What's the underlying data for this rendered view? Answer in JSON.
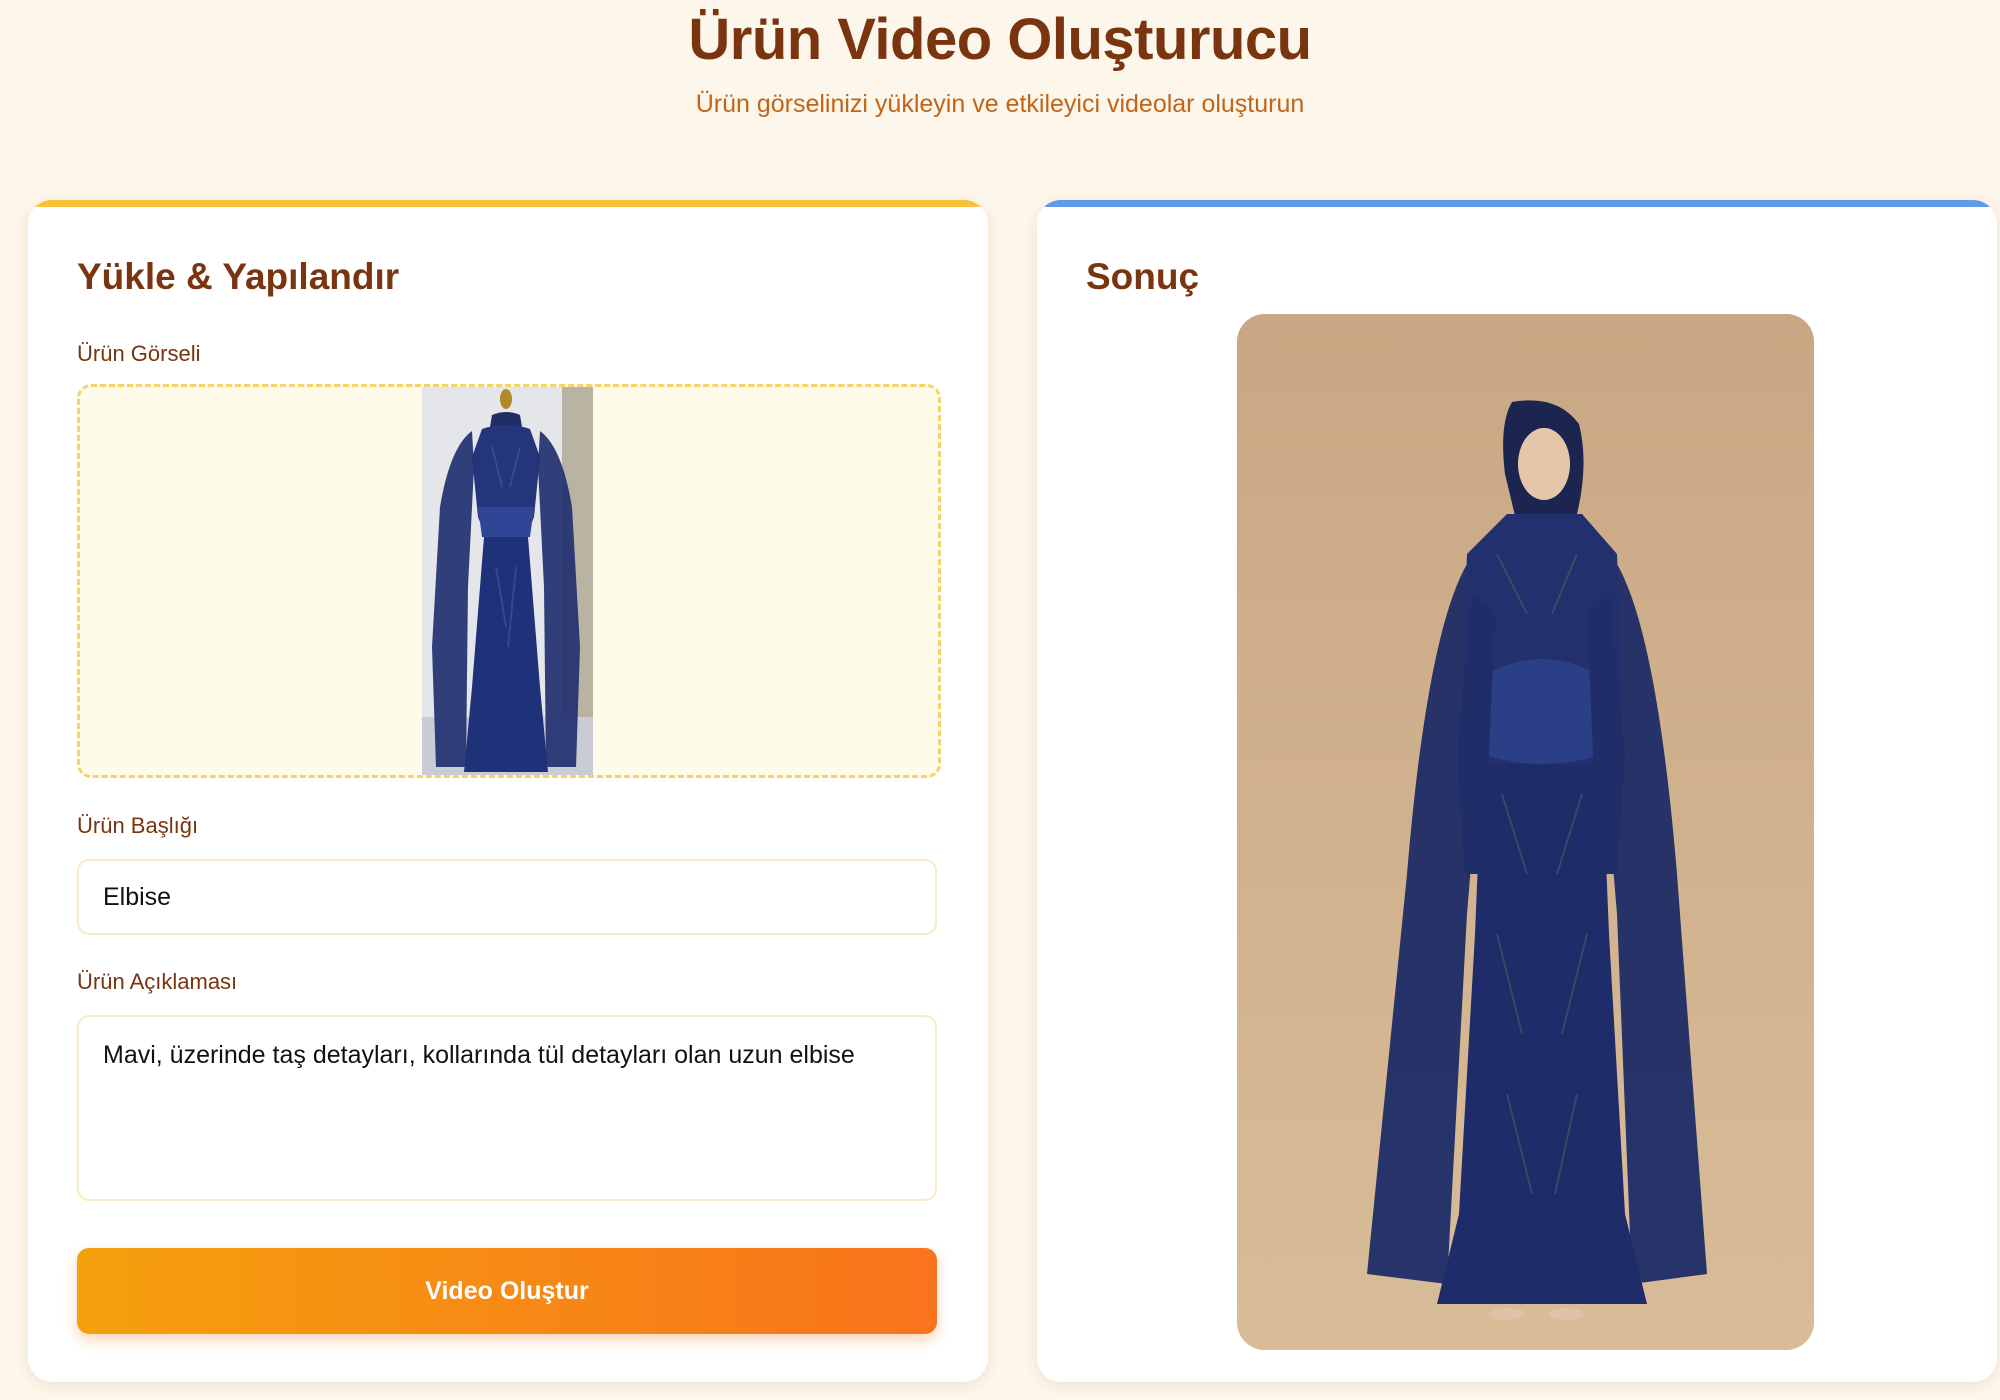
{
  "header": {
    "title": "Ürün Video Oluşturucu",
    "subtitle": "Ürün görselinizi yükleyin ve etkileyici videolar oluşturun"
  },
  "upload_panel": {
    "title": "Yükle & Yapılandır",
    "image_label": "Ürün Görseli",
    "title_label": "Ürün Başlığı",
    "title_value": "Elbise",
    "description_label": "Ürün Açıklaması",
    "description_value": "Mavi, üzerinde taş detayları, kollarında tül detayları olan uzun elbise",
    "button_label": "Video Oluştur"
  },
  "result_panel": {
    "title": "Sonuç"
  },
  "colors": {
    "accent_yellow": "#f5c23a",
    "accent_blue": "#5f9be8",
    "button_gradient_start": "#f5a00d",
    "button_gradient_end": "#f9731c",
    "heading": "#7a3410"
  }
}
